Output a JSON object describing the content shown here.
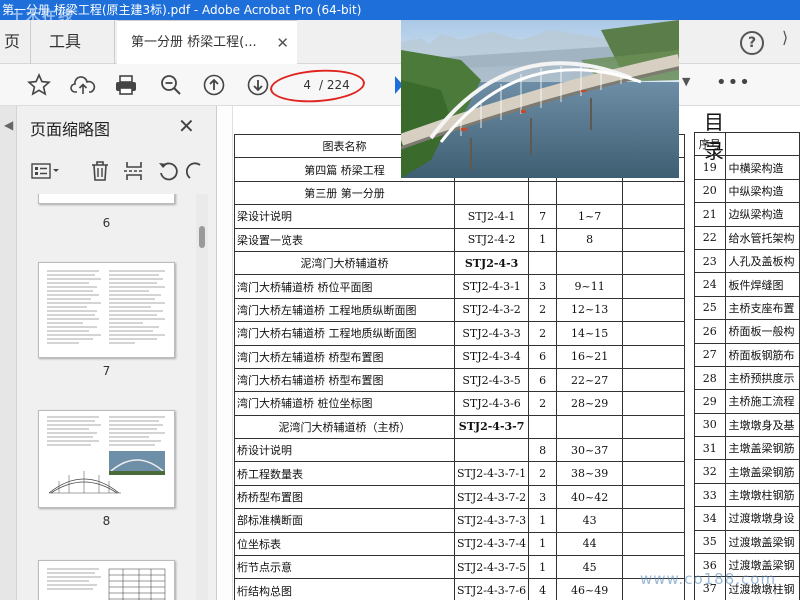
{
  "window": {
    "title": "第一分册 桥梁工程(原主建3标).pdf - Adobe Acrobat Pro (64-bit)",
    "watermark": "土木在线"
  },
  "tabs": {
    "home": "页",
    "tools": "工具",
    "document": "第一分册 桥梁工程(..."
  },
  "toolbar": {
    "current_page": "4",
    "total_pages": "/ 224",
    "more": "•••"
  },
  "sidebar": {
    "title": "页面缩略图",
    "thumbnails": [
      {
        "label": "6"
      },
      {
        "label": "7"
      },
      {
        "label": "8"
      }
    ]
  },
  "document": {
    "table_header": "图表名称",
    "rows": [
      {
        "name": "第四篇  桥梁工程",
        "code": "",
        "num": "",
        "pages": "",
        "style": "center"
      },
      {
        "name": "第三册  第一分册",
        "code": "",
        "num": "",
        "pages": "",
        "style": "center"
      },
      {
        "name": "梁设计说明",
        "code": "STJ2-4-1",
        "num": "7",
        "pages": "1~7",
        "style": ""
      },
      {
        "name": "梁设置一览表",
        "code": "STJ2-4-2",
        "num": "1",
        "pages": "8",
        "style": ""
      },
      {
        "name": "泥湾门大桥辅道桥",
        "code": "STJ2-4-3",
        "num": "",
        "pages": "",
        "style": "center-boldcode"
      },
      {
        "name": "湾门大桥辅道桥  桥位平面图",
        "code": "STJ2-4-3-1",
        "num": "3",
        "pages": "9~11",
        "style": ""
      },
      {
        "name": "湾门大桥左辅道桥  工程地质纵断面图",
        "code": "STJ2-4-3-2",
        "num": "2",
        "pages": "12~13",
        "style": ""
      },
      {
        "name": "湾门大桥右辅道桥  工程地质纵断面图",
        "code": "STJ2-4-3-3",
        "num": "2",
        "pages": "14~15",
        "style": ""
      },
      {
        "name": "湾门大桥左辅道桥  桥型布置图",
        "code": "STJ2-4-3-4",
        "num": "6",
        "pages": "16~21",
        "style": ""
      },
      {
        "name": "湾门大桥右辅道桥  桥型布置图",
        "code": "STJ2-4-3-5",
        "num": "6",
        "pages": "22~27",
        "style": ""
      },
      {
        "name": "湾门大桥辅道桥  桩位坐标图",
        "code": "STJ2-4-3-6",
        "num": "2",
        "pages": "28~29",
        "style": ""
      },
      {
        "name": "泥湾门大桥辅道桥（主桥）",
        "code": "STJ2-4-3-7",
        "num": "",
        "pages": "",
        "style": "center-boldcode"
      },
      {
        "name": "桥设计说明",
        "code": "",
        "num": "8",
        "pages": "30~37",
        "style": ""
      },
      {
        "name": "桥工程数量表",
        "code": "STJ2-4-3-7-1",
        "num": "2",
        "pages": "38~39",
        "style": ""
      },
      {
        "name": "桥桥型布置图",
        "code": "STJ2-4-3-7-2",
        "num": "3",
        "pages": "40~42",
        "style": ""
      },
      {
        "name": "部标准横断面",
        "code": "STJ2-4-3-7-3",
        "num": "1",
        "pages": "43",
        "style": ""
      },
      {
        "name": "位坐标表",
        "code": "STJ2-4-3-7-4",
        "num": "1",
        "pages": "44",
        "style": ""
      },
      {
        "name": "桁节点示意",
        "code": "STJ2-4-3-7-5",
        "num": "1",
        "pages": "45",
        "style": ""
      },
      {
        "name": "桁结构总图",
        "code": "STJ2-4-3-7-6",
        "num": "4",
        "pages": "46~49",
        "style": ""
      }
    ],
    "right_title": "目  录",
    "right_header": "序号",
    "right_rows": [
      {
        "no": "19",
        "name": "中横梁构造"
      },
      {
        "no": "20",
        "name": "中纵梁构造"
      },
      {
        "no": "21",
        "name": "边纵梁构造"
      },
      {
        "no": "22",
        "name": "给水管托架构"
      },
      {
        "no": "23",
        "name": "人孔及盖板构"
      },
      {
        "no": "24",
        "name": "板件焊缝图"
      },
      {
        "no": "25",
        "name": "主桥支座布置"
      },
      {
        "no": "26",
        "name": "桥面板一般构"
      },
      {
        "no": "27",
        "name": "桥面板钢筋布"
      },
      {
        "no": "28",
        "name": "主桥预拱度示"
      },
      {
        "no": "29",
        "name": "主桥施工流程"
      },
      {
        "no": "30",
        "name": "主墩墩身及基"
      },
      {
        "no": "31",
        "name": "主墩盖梁钢筋"
      },
      {
        "no": "32",
        "name": "主墩盖梁钢筋"
      },
      {
        "no": "33",
        "name": "主墩墩柱钢筋"
      },
      {
        "no": "34",
        "name": "过渡墩墩身设"
      },
      {
        "no": "35",
        "name": "过渡墩盖梁钢"
      },
      {
        "no": "36",
        "name": "过渡墩盖梁钢"
      },
      {
        "no": "37",
        "name": "过渡墩墩柱钢"
      }
    ]
  },
  "corner_watermark": "www.co188.com"
}
